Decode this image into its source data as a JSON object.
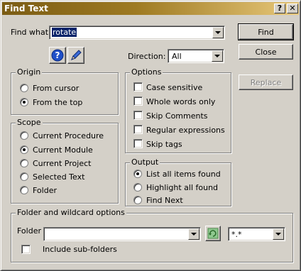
{
  "window": {
    "title": "Find Text",
    "help_glyph": "?",
    "close_glyph": "✕"
  },
  "find": {
    "label": "Find what:",
    "value": "rotate"
  },
  "buttons": {
    "find": "Find",
    "close": "Close",
    "replace": "Replace"
  },
  "icons": {
    "help": "help-icon",
    "pencil": "pencil-icon",
    "refresh": "refresh-icon"
  },
  "direction": {
    "label": "Direction:",
    "value": "All"
  },
  "origin": {
    "title": "Origin",
    "options": [
      "From cursor",
      "From the top"
    ],
    "selected": 1
  },
  "options": {
    "title": "Options",
    "items": [
      {
        "label": "Case sensitive",
        "checked": false
      },
      {
        "label": "Whole words only",
        "checked": false
      },
      {
        "label": "Skip Comments",
        "checked": false
      },
      {
        "label": "Regular expressions",
        "checked": false
      },
      {
        "label": "Skip tags",
        "checked": false
      }
    ]
  },
  "scope": {
    "title": "Scope",
    "options": [
      "Current Procedure",
      "Current Module",
      "Current Project",
      "Selected Text",
      "Folder"
    ],
    "selected": 1
  },
  "output": {
    "title": "Output",
    "options": [
      "List all items found",
      "Highlight all found",
      "Find Next"
    ],
    "selected": 0
  },
  "folder": {
    "title": "Folder and wildcard options",
    "label": "Folder",
    "value": "",
    "wildcard": "*.*",
    "include_sub": "Include sub-folders"
  },
  "colors": {
    "title_start": "#7b5c14",
    "title_end": "#e8c87a",
    "selection": "#0a246a",
    "face": "#d4d0c8"
  }
}
